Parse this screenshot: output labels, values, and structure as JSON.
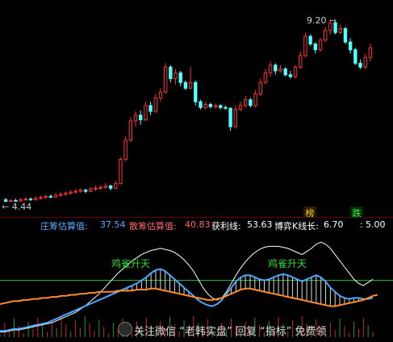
{
  "colors": {
    "up": "#ff3232",
    "down": "#54ffff",
    "white_line": "#ffffff",
    "blue_line": "#4aa8ff",
    "orange_line": "#ff8c2a",
    "green_ref": "#2fbf2f",
    "label_blue": "#5aaaff",
    "label_red": "#ff6666",
    "label_white": "#ffffff",
    "label_gray": "#bbbbbb",
    "badge_bg": "#111111",
    "badge_text": "#ffff00"
  },
  "price_panel": {
    "high_marker": "9.20",
    "low_marker": "4.44",
    "badges": [
      "榜",
      "跌"
    ]
  },
  "indicator": {
    "items": [
      {
        "label": "庄筹估算值:",
        "value": "37.54",
        "color": "label_blue"
      },
      {
        "label": "散筹估算值:",
        "value": "40.83",
        "color": "label_red"
      },
      {
        "label": "获利线:",
        "value": "53.63",
        "color": "label_white"
      },
      {
        "label": "博弈K线长:",
        "value": "6.70",
        "color": "label_white"
      },
      {
        "label": ":",
        "value": "5.00",
        "color": "label_white"
      }
    ],
    "annotations": [
      "鸡雀升天",
      "鸡雀升天"
    ]
  },
  "watermark": "关注微信 “老韩实盘” 回复 “指标” 免费领",
  "chart_data": [
    {
      "type": "candlestick",
      "title": "",
      "markers": {
        "high": 9.2,
        "low": 4.44
      },
      "ylim": [
        4.2,
        9.4
      ],
      "candles": [
        [
          4.5,
          4.46,
          4.55,
          4.44
        ],
        [
          4.46,
          4.48,
          4.52,
          4.44
        ],
        [
          4.48,
          4.47,
          4.53,
          4.45
        ],
        [
          4.47,
          4.5,
          4.54,
          4.45
        ],
        [
          4.5,
          4.52,
          4.57,
          4.47
        ],
        [
          4.52,
          4.5,
          4.56,
          4.47
        ],
        [
          4.5,
          4.54,
          4.59,
          4.48
        ],
        [
          4.54,
          4.56,
          4.61,
          4.5
        ],
        [
          4.56,
          4.59,
          4.63,
          4.53
        ],
        [
          4.59,
          4.57,
          4.64,
          4.54
        ],
        [
          4.57,
          4.62,
          4.68,
          4.55
        ],
        [
          4.62,
          4.64,
          4.7,
          4.58
        ],
        [
          4.64,
          4.67,
          4.72,
          4.61
        ],
        [
          4.67,
          4.7,
          4.75,
          4.63
        ],
        [
          4.7,
          4.72,
          4.78,
          4.66
        ],
        [
          4.72,
          4.75,
          4.8,
          4.68
        ],
        [
          4.75,
          4.72,
          4.79,
          4.67
        ],
        [
          4.72,
          4.78,
          4.84,
          4.7
        ],
        [
          4.78,
          4.8,
          4.87,
          4.73
        ],
        [
          4.8,
          4.82,
          4.89,
          4.76
        ],
        [
          4.82,
          4.86,
          4.93,
          4.78
        ],
        [
          4.86,
          4.8,
          4.9,
          4.74
        ],
        [
          4.8,
          4.92,
          5.0,
          4.78
        ],
        [
          4.92,
          5.55,
          5.6,
          4.9
        ],
        [
          5.55,
          6.05,
          6.15,
          5.5
        ],
        [
          6.05,
          6.55,
          6.65,
          6.0
        ],
        [
          6.55,
          6.7,
          6.8,
          6.4
        ],
        [
          6.7,
          6.58,
          6.82,
          6.45
        ],
        [
          6.58,
          6.95,
          7.05,
          6.55
        ],
        [
          6.95,
          6.8,
          7.05,
          6.7
        ],
        [
          6.8,
          7.15,
          7.25,
          6.75
        ],
        [
          7.15,
          7.3,
          7.4,
          7.05
        ],
        [
          7.3,
          7.95,
          8.05,
          7.25
        ],
        [
          7.95,
          7.65,
          8.0,
          7.55
        ],
        [
          7.65,
          7.8,
          7.9,
          7.5
        ],
        [
          7.8,
          7.55,
          7.85,
          7.45
        ],
        [
          7.55,
          7.4,
          7.6,
          7.35
        ],
        [
          7.4,
          7.55,
          7.95,
          7.38
        ],
        [
          7.55,
          7.05,
          7.6,
          6.95
        ],
        [
          7.05,
          6.9,
          7.1,
          6.85
        ],
        [
          6.9,
          6.98,
          7.05,
          6.85
        ],
        [
          6.98,
          6.92,
          7.02,
          6.88
        ],
        [
          6.92,
          6.95,
          7.0,
          6.86
        ],
        [
          6.95,
          6.9,
          6.98,
          6.85
        ],
        [
          6.9,
          6.88,
          6.95,
          6.84
        ],
        [
          6.88,
          6.4,
          6.9,
          6.3
        ],
        [
          6.4,
          6.85,
          6.95,
          6.35
        ],
        [
          6.85,
          6.95,
          7.05,
          6.8
        ],
        [
          6.95,
          7.1,
          7.2,
          6.9
        ],
        [
          7.1,
          6.95,
          7.15,
          6.9
        ],
        [
          6.95,
          7.25,
          7.35,
          6.9
        ],
        [
          7.25,
          7.55,
          7.65,
          7.2
        ],
        [
          7.55,
          7.8,
          7.9,
          7.5
        ],
        [
          7.8,
          8.0,
          8.1,
          7.7
        ],
        [
          8.0,
          7.85,
          8.05,
          7.75
        ],
        [
          7.85,
          7.9,
          8.0,
          7.8
        ],
        [
          7.9,
          7.75,
          7.95,
          7.7
        ],
        [
          7.75,
          7.7,
          7.85,
          7.65
        ],
        [
          7.7,
          7.95,
          8.0,
          7.65
        ],
        [
          7.95,
          8.25,
          8.35,
          7.9
        ],
        [
          8.25,
          8.75,
          8.85,
          8.2
        ],
        [
          8.75,
          8.55,
          8.8,
          8.5
        ],
        [
          8.55,
          8.4,
          8.6,
          8.3
        ],
        [
          8.4,
          8.65,
          8.7,
          8.35
        ],
        [
          8.65,
          8.9,
          9.0,
          8.6
        ],
        [
          8.9,
          9.1,
          9.2,
          8.8
        ],
        [
          9.1,
          8.85,
          9.15,
          8.8
        ],
        [
          8.85,
          8.95,
          9.05,
          8.8
        ],
        [
          8.95,
          8.6,
          9.0,
          8.55
        ],
        [
          8.6,
          8.4,
          8.7,
          8.3
        ],
        [
          8.4,
          8.05,
          8.45,
          8.0
        ],
        [
          8.05,
          7.95,
          8.15,
          7.9
        ],
        [
          7.95,
          8.2,
          8.3,
          7.9
        ],
        [
          8.2,
          8.45,
          8.55,
          8.1
        ]
      ]
    },
    {
      "type": "line",
      "title": "",
      "ylim": [
        0,
        100
      ],
      "reference_lines": [
        55
      ],
      "series": [
        {
          "name": "获利线",
          "color": "white_line",
          "values": [
            5,
            5,
            6,
            7,
            7,
            8,
            9,
            10,
            11,
            12,
            13,
            14,
            16,
            18,
            20,
            22,
            24,
            27,
            30,
            34,
            38,
            42,
            47,
            52,
            57,
            62,
            66,
            70,
            74,
            77,
            80,
            82,
            84,
            85,
            86,
            85,
            84,
            82,
            79,
            75,
            70,
            64,
            56,
            48,
            42,
            38,
            36,
            38,
            44,
            52,
            60,
            67,
            73,
            78,
            82,
            85,
            87,
            88,
            88,
            88,
            87,
            86,
            84,
            82,
            80,
            83,
            86,
            90,
            92,
            90,
            86,
            80,
            74,
            68,
            62,
            56,
            52,
            50,
            53,
            56
          ]
        },
        {
          "name": "庄筹估算值",
          "color": "blue_line",
          "values": [
            6,
            6,
            7,
            8,
            8,
            9,
            10,
            11,
            12,
            13,
            14,
            16,
            18,
            20,
            22,
            24,
            26,
            28,
            30,
            32,
            34,
            36,
            38,
            40,
            42,
            44,
            46,
            48,
            50,
            52,
            55,
            58,
            62,
            65,
            66,
            64,
            60,
            56,
            52,
            48,
            44,
            40,
            36,
            33,
            31,
            30,
            32,
            36,
            42,
            48,
            54,
            58,
            60,
            60,
            58,
            56,
            55,
            56,
            58,
            60,
            61,
            60,
            58,
            56,
            54,
            56,
            58,
            60,
            58,
            54,
            48,
            44,
            40,
            38,
            37,
            38,
            38,
            37,
            37,
            38
          ]
        },
        {
          "name": "散筹估算值",
          "color": "orange_line",
          "values": [
            32,
            33,
            34,
            35,
            35,
            36,
            36,
            37,
            37,
            38,
            38,
            39,
            39,
            40,
            40,
            41,
            41,
            42,
            42,
            43,
            43,
            44,
            44,
            44,
            44,
            45,
            45,
            45,
            45,
            46,
            46,
            46,
            47,
            47,
            46,
            45,
            44,
            43,
            42,
            41,
            40,
            39,
            38,
            37,
            36,
            36,
            37,
            38,
            40,
            42,
            44,
            46,
            47,
            47,
            46,
            45,
            44,
            43,
            42,
            41,
            40,
            39,
            38,
            37,
            36,
            35,
            34,
            33,
            32,
            31,
            30,
            30,
            31,
            32,
            33,
            34,
            35,
            36,
            38,
            40,
            41
          ]
        }
      ]
    }
  ]
}
